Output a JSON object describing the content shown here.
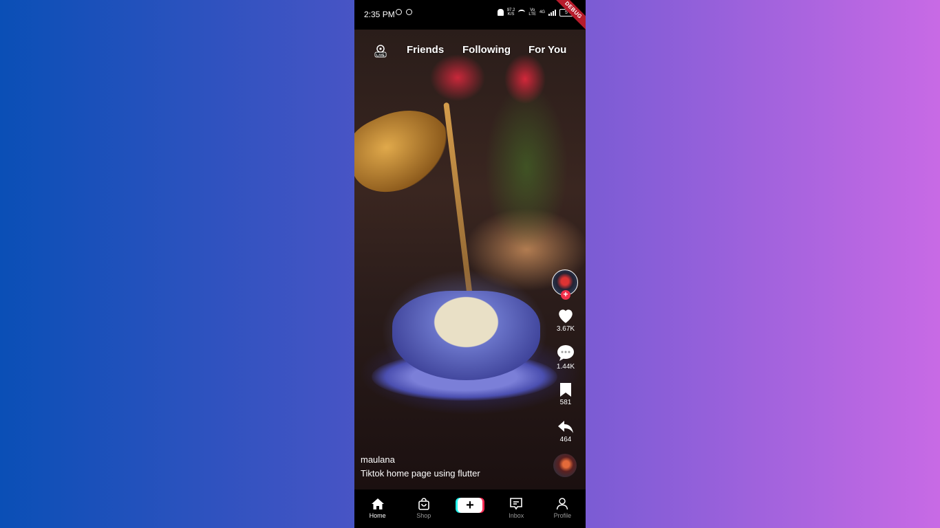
{
  "status_bar": {
    "time": "2:35 PM",
    "speed": "97.2",
    "speed_unit": "K/S",
    "network_left": "Vo",
    "network_left_sub": "LTE",
    "network_right": "4G",
    "battery": "5",
    "debug": "DEBUG"
  },
  "top_nav": {
    "live_label": "LIVE",
    "tabs": [
      "Friends",
      "Following",
      "For You"
    ]
  },
  "actions": {
    "likes": "3.67K",
    "comments": "1.44K",
    "bookmarks": "581",
    "shares": "464"
  },
  "caption": {
    "username": "maulana",
    "description": "Tiktok home page using flutter"
  },
  "bottom_nav": {
    "items": [
      "Home",
      "Shop",
      "+",
      "Inbox",
      "Profile"
    ],
    "active": "Home"
  },
  "colors": {
    "accent_red": "#fe2c55",
    "accent_cyan": "#25f4ee",
    "follow_plus": "#f0304a"
  }
}
